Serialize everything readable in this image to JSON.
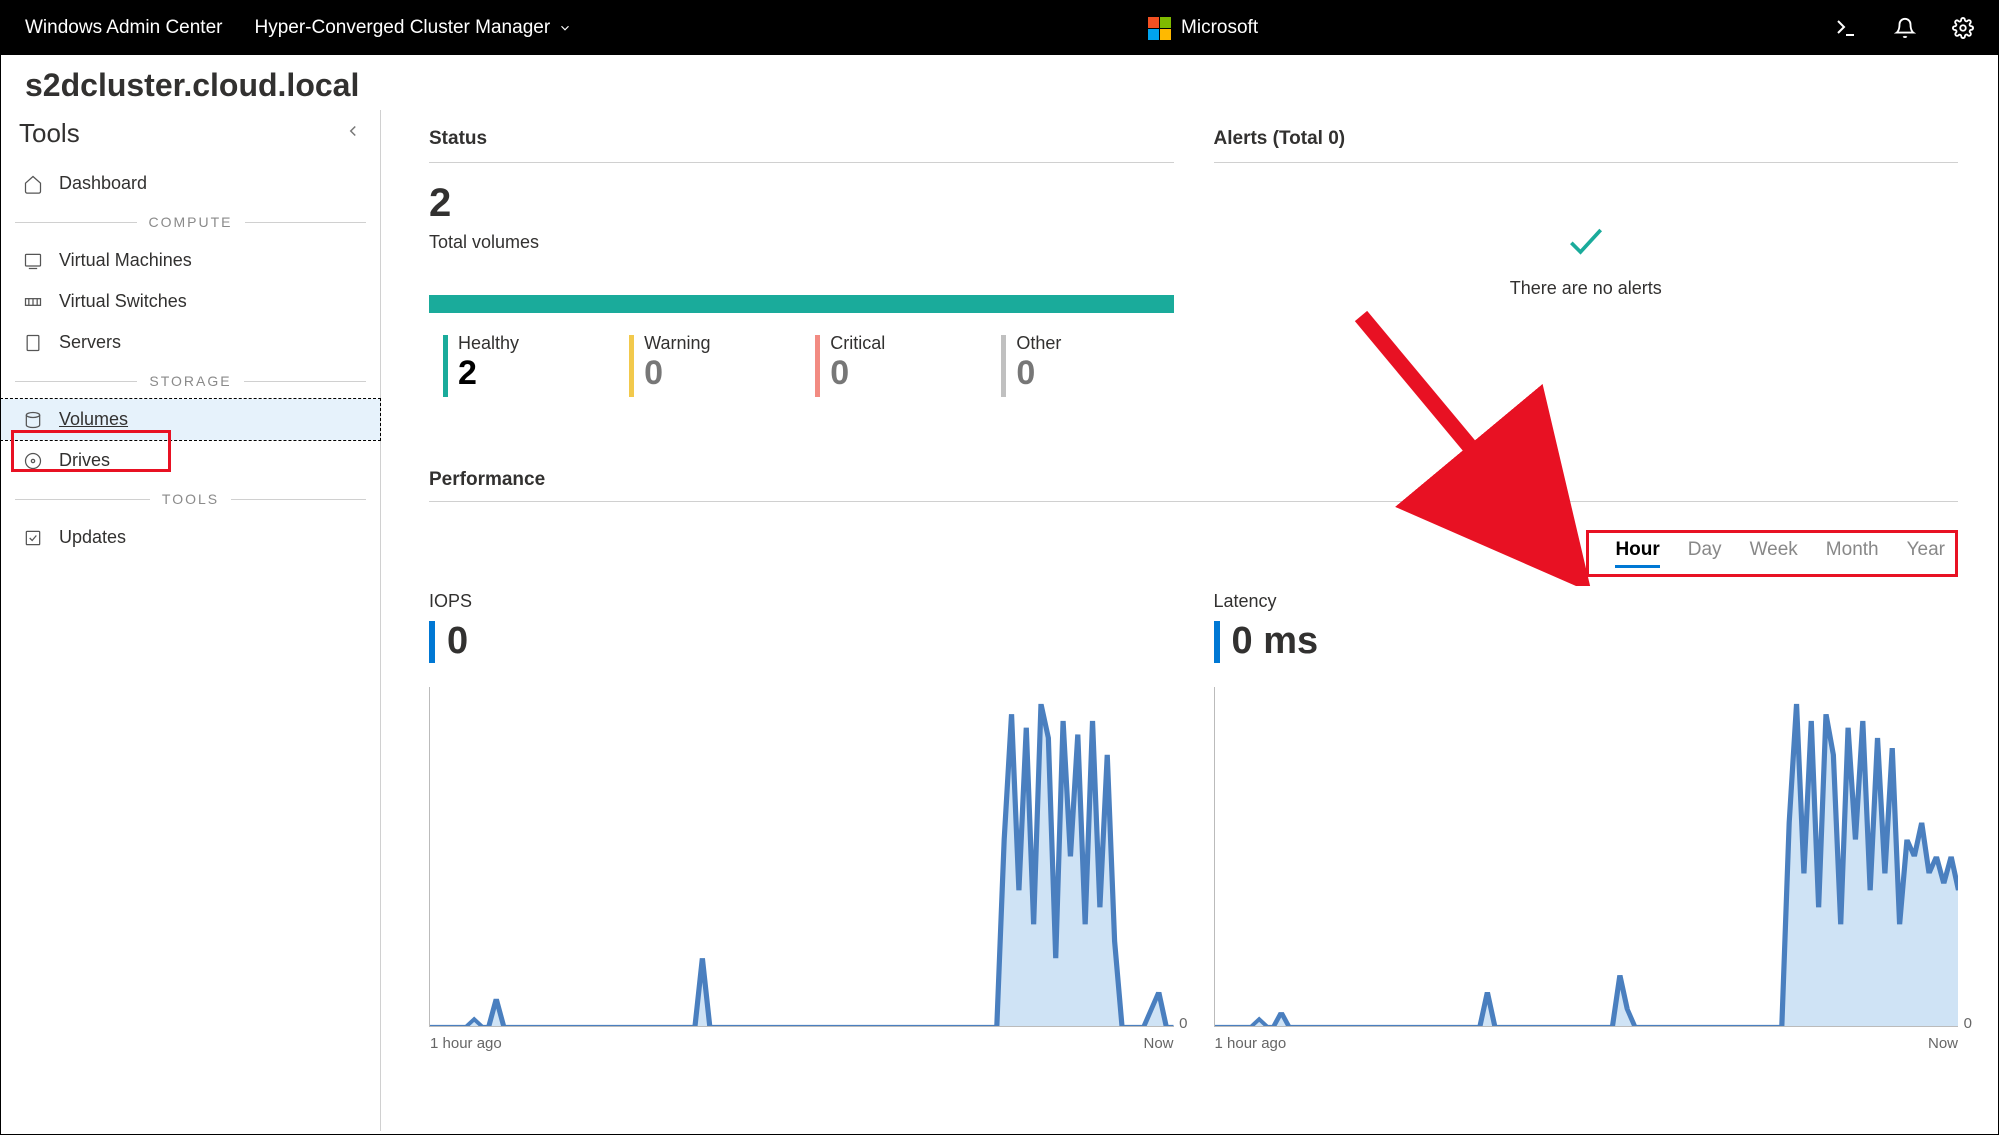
{
  "topbar": {
    "product": "Windows Admin Center",
    "context": "Hyper-Converged Cluster Manager",
    "brand": "Microsoft"
  },
  "cluster_name": "s2dcluster.cloud.local",
  "sidebar": {
    "title": "Tools",
    "items": [
      {
        "label": "Dashboard"
      }
    ],
    "section_compute": "COMPUTE",
    "compute_items": [
      {
        "label": "Virtual Machines"
      },
      {
        "label": "Virtual Switches"
      },
      {
        "label": "Servers"
      }
    ],
    "section_storage": "STORAGE",
    "storage_items": [
      {
        "label": "Volumes"
      },
      {
        "label": "Drives"
      }
    ],
    "section_tools": "TOOLS",
    "tools_items": [
      {
        "label": "Updates"
      }
    ]
  },
  "status": {
    "title": "Status",
    "total": "2",
    "total_label": "Total volumes",
    "cells": {
      "healthy": {
        "label": "Healthy",
        "value": "2"
      },
      "warning": {
        "label": "Warning",
        "value": "0"
      },
      "critical": {
        "label": "Critical",
        "value": "0"
      },
      "other": {
        "label": "Other",
        "value": "0"
      }
    }
  },
  "alerts": {
    "title": "Alerts (Total 0)",
    "empty_text": "There are no alerts"
  },
  "performance": {
    "title": "Performance",
    "tabs": [
      "Hour",
      "Day",
      "Week",
      "Month",
      "Year"
    ],
    "active_tab": "Hour",
    "iops": {
      "label": "IOPS",
      "value": "0"
    },
    "latency": {
      "label": "Latency",
      "value": "0 ms"
    },
    "x_start": "1 hour ago",
    "x_end": "Now",
    "y_zero": "0"
  },
  "chart_data": [
    {
      "type": "line",
      "title": "IOPS",
      "xlabel": "",
      "ylabel": "",
      "x_range": [
        "1 hour ago",
        "Now"
      ],
      "series": [
        {
          "name": "IOPS",
          "values_relative_0_to_1": [
            0,
            0,
            0,
            0,
            0,
            0,
            0.02,
            0,
            0,
            0.08,
            0,
            0,
            0,
            0,
            0,
            0,
            0,
            0,
            0,
            0,
            0,
            0,
            0,
            0,
            0,
            0,
            0,
            0,
            0,
            0,
            0,
            0,
            0,
            0,
            0,
            0,
            0,
            0.2,
            0,
            0,
            0,
            0,
            0,
            0,
            0,
            0,
            0,
            0,
            0,
            0,
            0,
            0,
            0,
            0,
            0,
            0,
            0,
            0,
            0,
            0,
            0,
            0,
            0,
            0,
            0,
            0,
            0,
            0,
            0,
            0,
            0,
            0,
            0,
            0,
            0,
            0,
            0,
            0,
            0.55,
            0.92,
            0.4,
            0.88,
            0.3,
            0.95,
            0.85,
            0.2,
            0.9,
            0.5,
            0.86,
            0.3,
            0.9,
            0.35,
            0.8,
            0.25,
            0,
            0,
            0,
            0,
            0.05,
            0.1,
            0,
            0
          ]
        }
      ]
    },
    {
      "type": "line",
      "title": "Latency (ms)",
      "xlabel": "",
      "ylabel": "",
      "x_range": [
        "1 hour ago",
        "Now"
      ],
      "series": [
        {
          "name": "Latency",
          "values_relative_0_to_1": [
            0,
            0,
            0,
            0,
            0,
            0,
            0.02,
            0,
            0,
            0.04,
            0,
            0,
            0,
            0,
            0,
            0,
            0,
            0,
            0,
            0,
            0,
            0,
            0,
            0,
            0,
            0,
            0,
            0,
            0,
            0,
            0,
            0,
            0,
            0,
            0,
            0,
            0,
            0.1,
            0,
            0,
            0,
            0,
            0,
            0,
            0,
            0,
            0,
            0,
            0,
            0,
            0,
            0,
            0,
            0,
            0,
            0.15,
            0.05,
            0,
            0,
            0,
            0,
            0,
            0,
            0,
            0,
            0,
            0,
            0,
            0,
            0,
            0,
            0,
            0,
            0,
            0,
            0,
            0,
            0,
            0.6,
            0.95,
            0.45,
            0.9,
            0.35,
            0.92,
            0.8,
            0.3,
            0.88,
            0.55,
            0.9,
            0.4,
            0.85,
            0.45,
            0.82,
            0.3,
            0.55,
            0.5,
            0.6,
            0.45,
            0.5,
            0.42,
            0.5,
            0.4
          ]
        }
      ]
    }
  ]
}
